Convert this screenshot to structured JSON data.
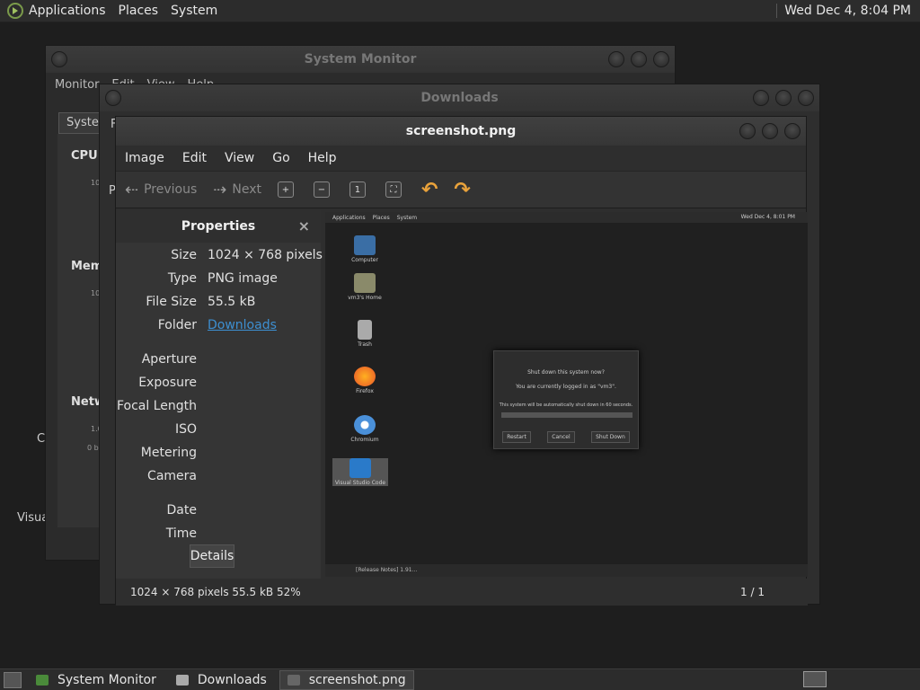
{
  "top_panel": {
    "menus": [
      "Applications",
      "Places",
      "System"
    ],
    "clock": "Wed Dec  4,  8:04 PM"
  },
  "sysmon_window": {
    "title": "System Monitor",
    "menu": [
      "Monitor",
      "Edit",
      "View",
      "Help"
    ],
    "tab": "System",
    "labels": {
      "cpu": "CPU I",
      "mem": "Mem",
      "net": "Netw"
    },
    "tiny": [
      "10",
      "10",
      "1.0",
      "0 by"
    ]
  },
  "downloads_window": {
    "title": "Downloads",
    "tab_partial": "F",
    "side_partial": "P"
  },
  "desktop_fragments": {
    "left1": "C",
    "left2": "Visua"
  },
  "eog_window": {
    "title": "screenshot.png",
    "menu": [
      "Image",
      "Edit",
      "View",
      "Go",
      "Help"
    ],
    "toolbar": {
      "previous": "Previous",
      "next": "Next"
    },
    "properties": {
      "heading": "Properties",
      "close": "×",
      "rows": [
        {
          "key": "Size",
          "value": "1024 × 768 pixels"
        },
        {
          "key": "Type",
          "value": "PNG image"
        },
        {
          "key": "File Size",
          "value": "55.5 kB"
        },
        {
          "key": "Folder",
          "value": "Downloads"
        }
      ],
      "exif": [
        "Aperture",
        "Exposure",
        "Focal Length",
        "ISO",
        "Metering",
        "Camera"
      ],
      "datetime": [
        "Date",
        "Time"
      ],
      "details_button": "Details"
    },
    "status": {
      "info": "1024 × 768 pixels  55.5 kB   52%",
      "page": "1 / 1"
    },
    "preview": {
      "top_menus": [
        "Applications",
        "Places",
        "System"
      ],
      "clock": "Wed Dec  4,  8:01 PM",
      "icons": [
        "Computer",
        "vm3's Home",
        "Trash",
        "Firefox",
        "Chromium",
        "Visual Studio Code"
      ],
      "dialog": {
        "question": "Shut down this system now?",
        "user": "You are currently logged in as \"vm3\".",
        "auto": "This system will be automatically shut down in 60 seconds.",
        "buttons": [
          "Restart",
          "Cancel",
          "Shut Down"
        ]
      },
      "taskbar_item": "[Release Notes] 1.91..."
    }
  },
  "taskbar": {
    "items": [
      "System Monitor",
      "Downloads",
      "screenshot.png"
    ]
  }
}
